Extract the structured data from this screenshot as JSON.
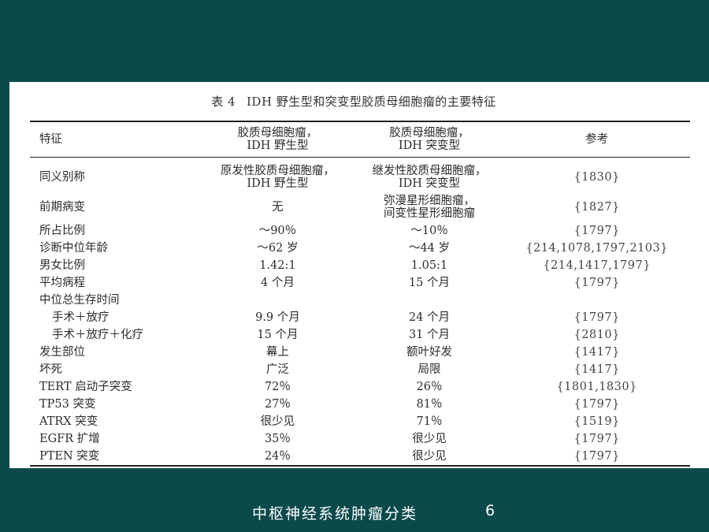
{
  "table": {
    "caption_label": "表 4",
    "caption_title": "IDH 野生型和突变型胶质母细胞瘤的主要特征",
    "headers": [
      "特征",
      "胶质母细胞瘤，\nIDH 野生型",
      "胶质母细胞瘤，\nIDH 突变型",
      "参考"
    ],
    "rows": [
      {
        "feature": "同义别称",
        "wild": "原发性胶质母细胞瘤，\nIDH 野生型",
        "mutant": "继发性胶质母细胞瘤，\nIDH 突变型",
        "ref": "{1830}"
      },
      {
        "feature": "前期病变",
        "wild": "无",
        "mutant": "弥漫星形细胞瘤，\n间变性星形细胞瘤",
        "ref": "{1827}"
      },
      {
        "feature": "所占比例",
        "wild": "～90％",
        "mutant": "～10％",
        "ref": "{1797}"
      },
      {
        "feature": "诊断中位年龄",
        "wild": "～62 岁",
        "mutant": "～44 岁",
        "ref": "{214,1078,1797,2103}"
      },
      {
        "feature": "男女比例",
        "wild": "1.42:1",
        "mutant": "1.05:1",
        "ref": "{214,1417,1797}"
      },
      {
        "feature": "平均病程",
        "wild": "4 个月",
        "mutant": "15 个月",
        "ref": "{1797}"
      },
      {
        "feature": "中位总生存时间",
        "wild": "",
        "mutant": "",
        "ref": ""
      },
      {
        "feature": "手术＋放疗",
        "wild": "9.9 个月",
        "mutant": "24 个月",
        "ref": "{1797}"
      },
      {
        "feature": "手术＋放疗＋化疗",
        "wild": "15 个月",
        "mutant": "31 个月",
        "ref": "{2810}"
      },
      {
        "feature": "发生部位",
        "wild": "幕上",
        "mutant": "额叶好发",
        "ref": "{1417}"
      },
      {
        "feature": "坏死",
        "wild": "广泛",
        "mutant": "局限",
        "ref": "{1417}"
      },
      {
        "feature": "TERT 启动子突变",
        "wild": "72％",
        "mutant": "26％",
        "ref": "{1801,1830}"
      },
      {
        "feature": "TP53 突变",
        "wild": "27％",
        "mutant": "81％",
        "ref": "{1797}"
      },
      {
        "feature": "ATRX 突变",
        "wild": "很少见",
        "mutant": "71％",
        "ref": "{1519}"
      },
      {
        "feature": "EGFR 扩增",
        "wild": "35％",
        "mutant": "很少见",
        "ref": "{1797}"
      },
      {
        "feature": "PTEN 突变",
        "wild": "24％",
        "mutant": "很少见",
        "ref": "{1797}"
      }
    ]
  },
  "footer": {
    "title": "中枢神经系统肿瘤分类",
    "page_number": "6"
  },
  "colors": {
    "background": "#0b4a4b",
    "paper": "#ffffff",
    "text": "#2c2c2c"
  }
}
